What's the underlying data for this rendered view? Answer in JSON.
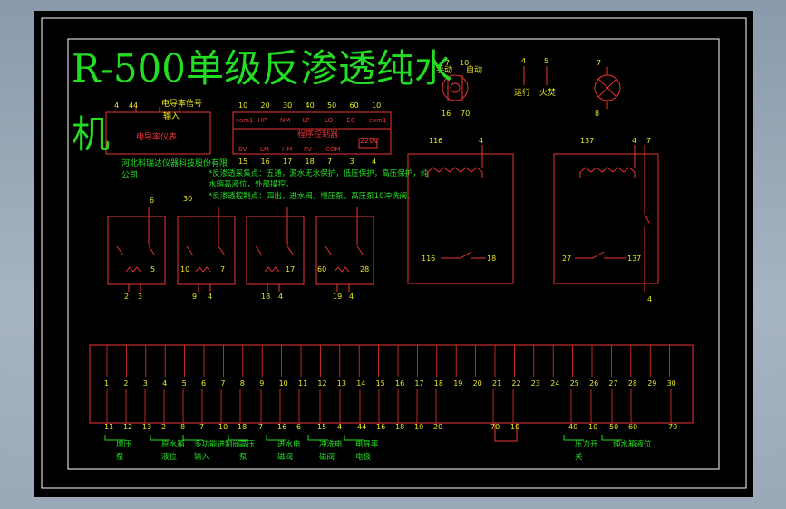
{
  "drawing": {
    "title_line1": "R-500单级反渗透纯水",
    "title_line2": "机"
  },
  "labels": {
    "conductivity_meter": "电导率仪表",
    "conductivity_signal": "电导率信号",
    "signal_input": "输入",
    "manual": "手动",
    "auto": "自动",
    "run": "运行",
    "fire": "火焚",
    "program_controller": "程序控制器",
    "voltage": "220V",
    "company_line1": "河北科瑞达仪器科技股份有限",
    "company_line2": "公司",
    "note1_line1": "*反渗透采集点：五通，源水无水保护，低压保护，高压保护，纯",
    "note1_line2": "水箱高液位，外部操控。",
    "note2": "*反渗透控制点：四出，进水阀，增压泵，高压泵10冲洗阀。",
    "ctrl_row1": [
      "com1",
      "HP",
      "NM",
      "LP",
      "LO",
      "EC",
      "com1"
    ],
    "ctrl_row2": [
      "BV",
      "LM",
      "HM",
      "FV",
      "COM"
    ],
    "switch_top": [
      "7",
      "10"
    ],
    "switch_bottom": [
      "16",
      "70"
    ],
    "lamp_top": "7",
    "lamp_bottom": "8",
    "run_fire_nums": [
      "4",
      "5"
    ],
    "meter_nums": [
      "4",
      "44"
    ],
    "ctrl_top_nums": [
      "10",
      "20",
      "30",
      "40",
      "50",
      "60",
      "10"
    ],
    "ctrl_bot_nums": [
      "15",
      "16",
      "17",
      "18",
      "7",
      "3",
      "4"
    ],
    "relay_top_nums": [
      "6",
      "30"
    ],
    "relay_side_nums": [
      "5",
      "10",
      "7",
      "17",
      "60",
      "28"
    ],
    "relay_bottom_nums": [
      "2",
      "3",
      "9",
      "4",
      "18",
      "4",
      "19",
      "4"
    ],
    "contactor_left": [
      "116",
      "4",
      "116",
      "18"
    ],
    "contactor_right": [
      "137",
      "4",
      "7",
      "27",
      "137",
      "4"
    ]
  },
  "terminal": {
    "upper": [
      "1",
      "2",
      "3",
      "4",
      "5",
      "6",
      "7",
      "8",
      "9",
      "10",
      "11",
      "12",
      "13",
      "14",
      "15",
      "16",
      "17",
      "18",
      "19",
      "20",
      "21",
      "22",
      "23",
      "24",
      "25",
      "26",
      "27",
      "28",
      "29",
      "30"
    ],
    "lower": [
      "11",
      "12",
      "13",
      "2",
      "8",
      "7",
      "10",
      "18",
      "7",
      "16",
      "6",
      "15",
      "4",
      "44",
      "16",
      "18",
      "10",
      "20",
      "70",
      "10",
      "40",
      "10",
      "50",
      "60",
      "70"
    ],
    "groups": [
      {
        "l1": "增压",
        "l2": "泵"
      },
      {
        "l1": "原水箱",
        "l2": "液位"
      },
      {
        "l1": "多功能进制阀",
        "l2": "输入"
      },
      {
        "l1": "高压",
        "l2": "泵"
      },
      {
        "l1": "进水电",
        "l2": "磁阀"
      },
      {
        "l1": "冲洗电",
        "l2": "磁阀"
      },
      {
        "l1": "电导率",
        "l2": "电极"
      },
      {
        "l1": "压力开",
        "l2": "关"
      },
      {
        "l1": "纯水箱液位",
        "l2": ""
      }
    ]
  }
}
